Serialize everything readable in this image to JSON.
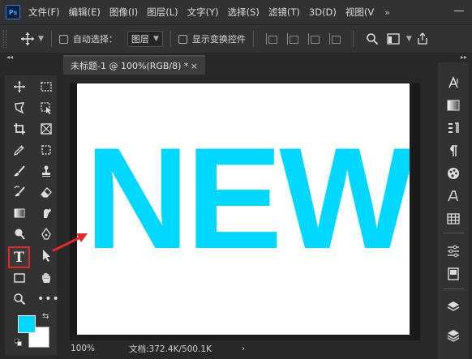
{
  "app": {
    "logo_text": "Ps"
  },
  "menu": {
    "items": [
      "文件(F)",
      "编辑(E)",
      "图像(I)",
      "图层(L)",
      "文字(Y)",
      "选择(S)",
      "滤镜(T)",
      "3D(D)",
      "视图(V"
    ],
    "more": "»"
  },
  "options": {
    "auto_select_label": "自动选择：",
    "layer_select_value": "图层",
    "show_transform_label": "显示变换控件"
  },
  "document": {
    "tab_title": "未标题-1 @ 100%(RGB/8) *",
    "tab_close": "×",
    "canvas_text": "NEW",
    "text_color": "#00d8ff",
    "canvas_color": "#ffffff"
  },
  "status": {
    "zoom": "100%",
    "doc_size": "文档:372.4K/500.1K",
    "arrow": "›"
  },
  "tools": {
    "text_tool_glyph": "T",
    "more_glyph": "•••",
    "foreground_color": "#00d8ff",
    "background_color": "#ffffff"
  },
  "right_panel": {
    "items": [
      "character-icon",
      "gradient-icon",
      "paragraph-style-icon",
      "paragraph-icon",
      "swatches-icon",
      "glyphs-icon",
      "table-icon",
      "adjustments-icon",
      "libraries-icon",
      "layers-icon",
      "layers-comp-icon"
    ]
  },
  "accent": {
    "highlight": "#e02a2a"
  }
}
